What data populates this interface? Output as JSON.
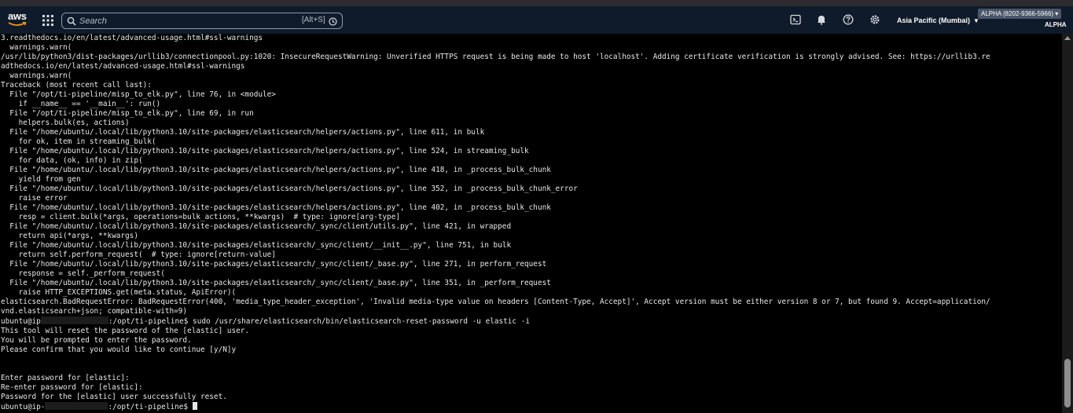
{
  "header": {
    "logo_text": "aws",
    "search": {
      "placeholder": "Search",
      "shortcut": "[Alt+S]"
    },
    "region": "Asia Pacific (Mumbai)",
    "account_badge": "ALPHA (8202-9366-5966)",
    "account_label": "ALPHA"
  },
  "icons": {
    "services": "grid-icon",
    "search": "search-icon",
    "cloudshell": "cloudshell-icon",
    "notifications": "bell-icon",
    "help": "help-icon",
    "settings": "gear-icon"
  },
  "terminal": {
    "lines": [
      "3.readthedocs.io/en/latest/advanced-usage.html#ssl-warnings",
      "  warnings.warn(",
      "/usr/lib/python3/dist-packages/urllib3/connectionpool.py:1020: InsecureRequestWarning: Unverified HTTPS request is being made to host 'localhost'. Adding certificate verification is strongly advised. See: https://urllib3.re",
      "adthedocs.io/en/latest/advanced-usage.html#ssl-warnings",
      "  warnings.warn(",
      "Traceback (most recent call last):",
      "  File \"/opt/ti-pipeline/misp_to_elk.py\", line 76, in <module>",
      "    if __name__ == '__main__': run()",
      "  File \"/opt/ti-pipeline/misp_to_elk.py\", line 69, in run",
      "    helpers.bulk(es, actions)",
      "  File \"/home/ubuntu/.local/lib/python3.10/site-packages/elasticsearch/helpers/actions.py\", line 611, in bulk",
      "    for ok, item in streaming_bulk(",
      "  File \"/home/ubuntu/.local/lib/python3.10/site-packages/elasticsearch/helpers/actions.py\", line 524, in streaming_bulk",
      "    for data, (ok, info) in zip(",
      "  File \"/home/ubuntu/.local/lib/python3.10/site-packages/elasticsearch/helpers/actions.py\", line 418, in _process_bulk_chunk",
      "    yield from gen",
      "  File \"/home/ubuntu/.local/lib/python3.10/site-packages/elasticsearch/helpers/actions.py\", line 352, in _process_bulk_chunk_error",
      "    raise error",
      "  File \"/home/ubuntu/.local/lib/python3.10/site-packages/elasticsearch/helpers/actions.py\", line 402, in _process_bulk_chunk",
      "    resp = client.bulk(*args, operations=bulk_actions, **kwargs)  # type: ignore[arg-type]",
      "  File \"/home/ubuntu/.local/lib/python3.10/site-packages/elasticsearch/_sync/client/utils.py\", line 421, in wrapped",
      "    return api(*args, **kwargs)",
      "  File \"/home/ubuntu/.local/lib/python3.10/site-packages/elasticsearch/_sync/client/__init__.py\", line 751, in bulk",
      "    return self.perform_request(  # type: ignore[return-value]",
      "  File \"/home/ubuntu/.local/lib/python3.10/site-packages/elasticsearch/_sync/client/_base.py\", line 271, in perform_request",
      "    response = self._perform_request(",
      "  File \"/home/ubuntu/.local/lib/python3.10/site-packages/elasticsearch/_sync/client/_base.py\", line 351, in _perform_request",
      "    raise HTTP_EXCEPTIONS.get(meta.status, ApiError)(",
      "elasticsearch.BadRequestError: BadRequestError(400, 'media_type_header_exception', 'Invalid media-type value on headers [Content-Type, Accept]', Accept version must be either version 8 or 7, but found 9. Accept=application/",
      "vnd.elasticsearch+json; compatible-with=9)"
    ],
    "prompt1_user": "ubuntu@ip",
    "prompt1_rest": ":/opt/ti-pipeline$ sudo /usr/share/elasticsearch/bin/elasticsearch-reset-password -u elastic -i",
    "lines2": [
      "This tool will reset the password of the [elastic] user.",
      "You will be prompted to enter the password.",
      "Please confirm that you would like to continue [y/N]y",
      "",
      "",
      "Enter password for [elastic]:",
      "Re-enter password for [elastic]:",
      "Password for the [elastic] user successfully reset."
    ],
    "prompt2_user": "ubuntu@ip-",
    "prompt2_rest": ":/opt/ti-pipeline$ "
  }
}
